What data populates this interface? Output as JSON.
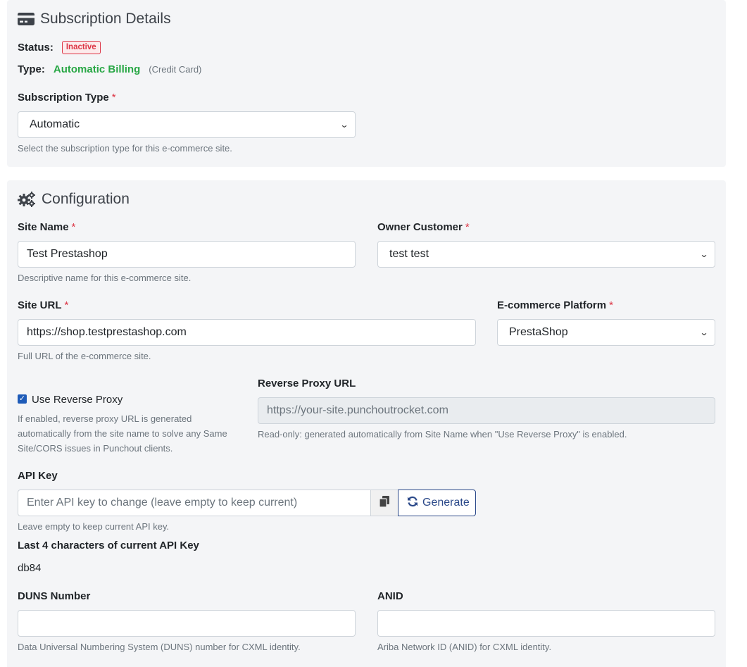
{
  "subscription": {
    "title": "Subscription Details",
    "status_label": "Status:",
    "status_badge": "Inactive",
    "type_label": "Type:",
    "type_value": "Automatic Billing",
    "type_note": "(Credit Card)",
    "sub_type_label": "Subscription Type",
    "required_mark": "*",
    "sub_type_value": "Automatic",
    "sub_type_help": "Select the subscription type for this e-commerce site."
  },
  "config": {
    "title": "Configuration",
    "site_name_label": "Site Name",
    "site_name_value": "Test Prestashop",
    "site_name_help": "Descriptive name for this e-commerce site.",
    "owner_label": "Owner Customer",
    "owner_value": "test test",
    "site_url_label": "Site URL",
    "site_url_value": "https://shop.testprestashop.com",
    "site_url_help": "Full URL of the e-commerce site.",
    "platform_label": "E-commerce Platform",
    "platform_value": "PrestaShop",
    "reverse_proxy_checkbox_label": "Use Reverse Proxy",
    "reverse_proxy_checked": true,
    "reverse_proxy_help": "If enabled, reverse proxy URL is generated automatically from the site name to solve any Same Site/CORS issues in Punchout clients.",
    "reverse_proxy_url_label": "Reverse Proxy URL",
    "reverse_proxy_url_placeholder": "https://your-site.punchoutrocket.com",
    "reverse_proxy_url_help": "Read-only: generated automatically from Site Name when \"Use Reverse Proxy\" is enabled.",
    "api_key_label": "API Key",
    "api_key_placeholder": "Enter API key to change (leave empty to keep current)",
    "generate_label": "Generate",
    "api_key_help": "Leave empty to keep current API key.",
    "last4_label": "Last 4 characters of current API Key",
    "last4_value": "db84",
    "duns_label": "DUNS Number",
    "duns_value": "",
    "duns_help": "Data Universal Numbering System (DUNS) number for CXML identity.",
    "anid_label": "ANID",
    "anid_value": "",
    "anid_help": "Ariba Network ID (ANID) for CXML identity."
  },
  "colors": {
    "danger": "#dc3545",
    "success": "#28a745",
    "primary": "#2c4a8a",
    "card_bg": "#f4f5f7"
  },
  "icons": [
    "credit-card-icon",
    "gears-icon",
    "chevron-down-icon",
    "copy-icon",
    "refresh-icon",
    "check-icon"
  ]
}
